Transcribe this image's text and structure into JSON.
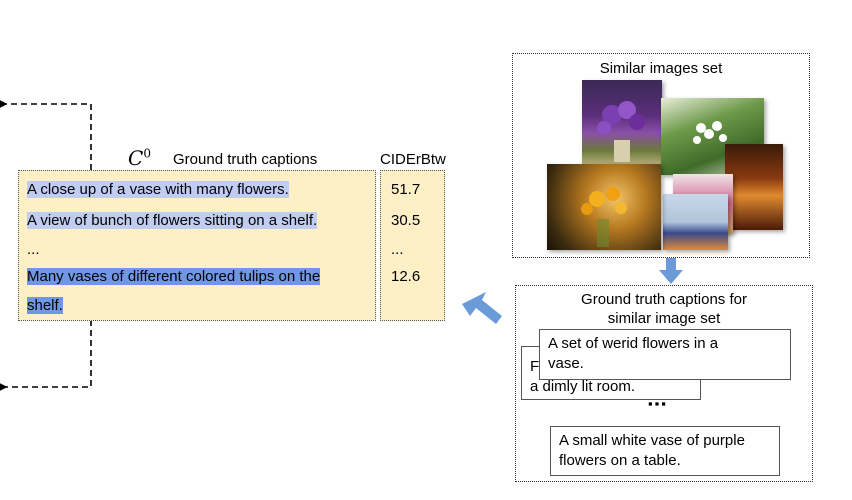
{
  "variable_label": "C",
  "variable_superscript": "0",
  "headers": {
    "captions": "Ground truth captions",
    "score": "CIDErBtw"
  },
  "captions": [
    {
      "text": "A close up of a vase with many flowers.",
      "score": "51.7"
    },
    {
      "text": "A view of bunch of flowers sitting on a shelf.",
      "score": "30.5"
    },
    {
      "text": "...",
      "score": "..."
    },
    {
      "text_line1": "Many vases of different colored tulips on the",
      "text_line2": "shelf.",
      "score": "12.6"
    }
  ],
  "similar_set": {
    "title": "Similar images set"
  },
  "similar_captions": {
    "title_line1": "Ground truth captions for",
    "title_line2": "similar image set",
    "back_card_line1": "F",
    "back_card_line2": "a dimly lit room.",
    "front_card_line1": "A set of werid flowers in a",
    "front_card_line2": "vase.",
    "ellipsis": "▪▪▪",
    "bottom_card_line1": "A small white vase of purple",
    "bottom_card_line2": "flowers on a table."
  },
  "colors": {
    "box_fill": "#fdefc6",
    "highlight_light": "#c0cdf0",
    "highlight_dark": "#6f97e6",
    "arrow_blue": "#6a9bd8"
  }
}
